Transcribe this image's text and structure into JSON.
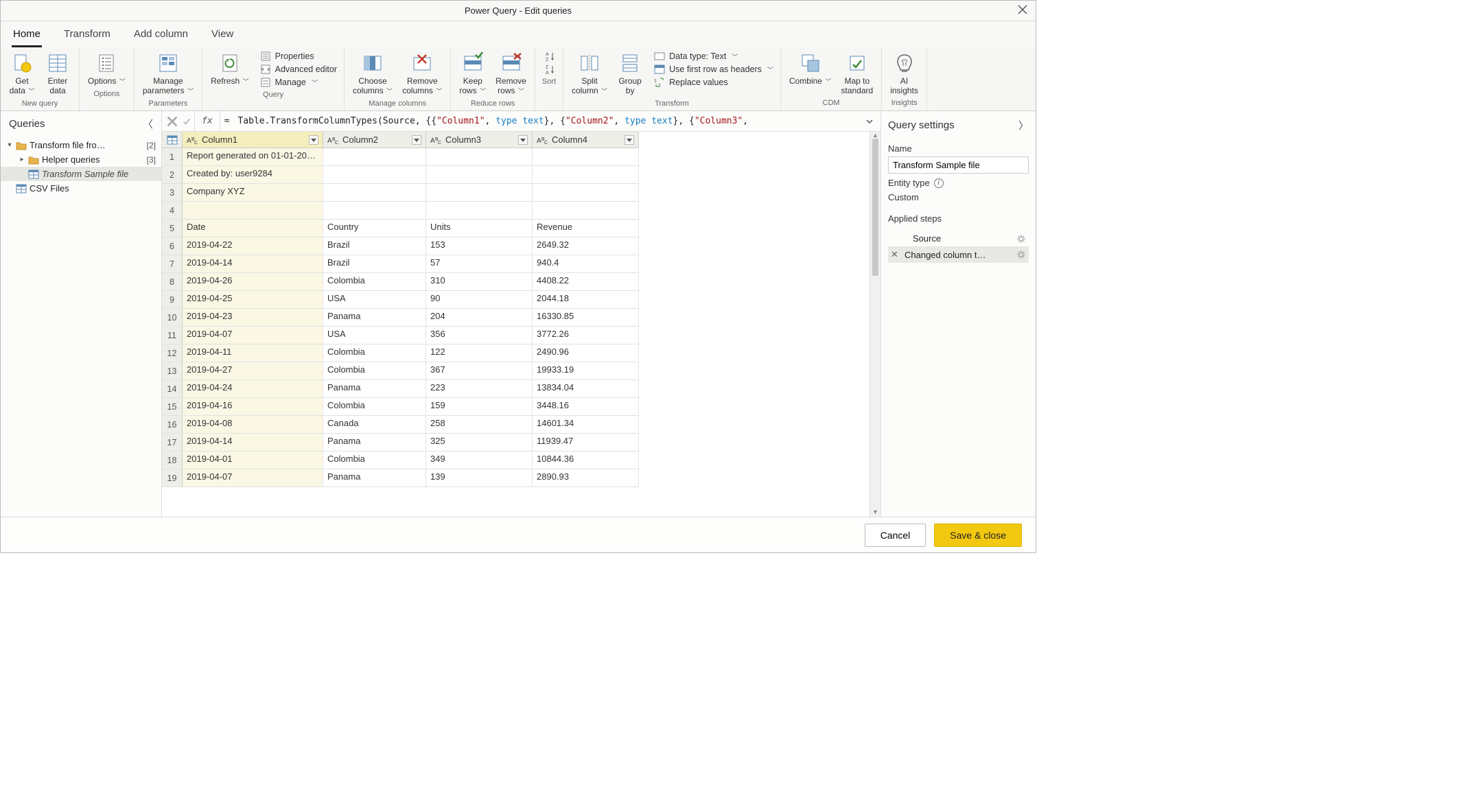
{
  "title": "Power Query - Edit queries",
  "tabs": [
    "Home",
    "Transform",
    "Add column",
    "View"
  ],
  "active_tab": 0,
  "ribbon": {
    "groups": [
      {
        "label": "New query",
        "buttons_lg": [
          {
            "label": "Get\ndata",
            "drop": true,
            "name": "get-data"
          },
          {
            "label": "Enter\ndata",
            "name": "enter-data"
          }
        ],
        "buttons_sm": []
      },
      {
        "label": "Options",
        "buttons_lg": [
          {
            "label": "Options",
            "drop": true,
            "name": "options"
          }
        ],
        "buttons_sm": []
      },
      {
        "label": "Parameters",
        "buttons_lg": [
          {
            "label": "Manage\nparameters",
            "drop": true,
            "name": "manage-parameters"
          }
        ],
        "buttons_sm": []
      },
      {
        "label": "Query",
        "buttons_lg": [
          {
            "label": "Refresh",
            "drop": true,
            "name": "refresh"
          }
        ],
        "buttons_sm": [
          {
            "label": "Properties",
            "name": "properties"
          },
          {
            "label": "Advanced editor",
            "name": "advanced-editor"
          },
          {
            "label": "Manage",
            "drop": true,
            "name": "manage-query"
          }
        ]
      },
      {
        "label": "Manage columns",
        "buttons_lg": [
          {
            "label": "Choose\ncolumns",
            "drop": true,
            "name": "choose-columns"
          },
          {
            "label": "Remove\ncolumns",
            "drop": true,
            "name": "remove-columns"
          }
        ],
        "buttons_sm": []
      },
      {
        "label": "Reduce rows",
        "buttons_lg": [
          {
            "label": "Keep\nrows",
            "drop": true,
            "name": "keep-rows"
          },
          {
            "label": "Remove\nrows",
            "drop": true,
            "name": "remove-rows"
          }
        ],
        "buttons_sm": []
      },
      {
        "label": "Sort",
        "buttons_lg": [],
        "buttons_sm": [
          {
            "label": "",
            "name": "sort-asc"
          },
          {
            "label": "",
            "name": "sort-desc"
          }
        ],
        "stacked": true
      },
      {
        "label": "Transform",
        "buttons_lg": [
          {
            "label": "Split\ncolumn",
            "drop": true,
            "name": "split-column"
          },
          {
            "label": "Group\nby",
            "name": "group-by"
          }
        ],
        "buttons_sm": [
          {
            "label": "Data type: Text",
            "drop": true,
            "name": "data-type"
          },
          {
            "label": "Use first row as headers",
            "drop": true,
            "name": "first-row-headers"
          },
          {
            "label": "Replace values",
            "name": "replace-values"
          }
        ]
      },
      {
        "label": "CDM",
        "buttons_lg": [
          {
            "label": "Combine",
            "drop": true,
            "name": "combine"
          },
          {
            "label": "Map to\nstandard",
            "name": "map-to-standard"
          }
        ],
        "buttons_sm": []
      },
      {
        "label": "Insights",
        "buttons_lg": [
          {
            "label": "AI\ninsights",
            "name": "ai-insights"
          }
        ],
        "buttons_sm": []
      }
    ]
  },
  "queries_pane": {
    "title": "Queries",
    "items": [
      {
        "indent": 0,
        "expand": "▾",
        "icon": "folder",
        "label": "Transform file fro…",
        "count": "[2]",
        "name": "folder-transform-file-from"
      },
      {
        "indent": 1,
        "expand": "▸",
        "icon": "folder",
        "label": "Helper queries",
        "count": "[3]",
        "name": "folder-helper-queries"
      },
      {
        "indent": 1,
        "expand": "",
        "icon": "table",
        "label": "Transform Sample file",
        "selected": true,
        "italic": true,
        "name": "query-transform-sample-file"
      },
      {
        "indent": 0,
        "expand": "",
        "icon": "table",
        "label": "CSV Files",
        "name": "query-csv-files"
      }
    ]
  },
  "formula_bar": {
    "prefix": "Table.TransformColumnTypes(Source, {{",
    "s1": "\"Column1\"",
    "mid1": ", ",
    "kw": "type text",
    "mid2": "}, {",
    "s2": "\"Column2\"",
    "mid3": ", ",
    "kw2": "type text",
    "mid4": "}, {",
    "s3": "\"Column3\"",
    "tail": ","
  },
  "grid": {
    "columns": [
      {
        "name": "Column1",
        "selected": true
      },
      {
        "name": "Column2"
      },
      {
        "name": "Column3"
      },
      {
        "name": "Column4"
      }
    ],
    "rows": [
      [
        "Report generated on 01-01-20…",
        "",
        "",
        ""
      ],
      [
        "Created by: user9284",
        "",
        "",
        ""
      ],
      [
        "Company XYZ",
        "",
        "",
        ""
      ],
      [
        "",
        "",
        "",
        ""
      ],
      [
        "Date",
        "Country",
        "Units",
        "Revenue"
      ],
      [
        "2019-04-22",
        "Brazil",
        "153",
        "2649.32"
      ],
      [
        "2019-04-14",
        "Brazil",
        "57",
        "940.4"
      ],
      [
        "2019-04-26",
        "Colombia",
        "310",
        "4408.22"
      ],
      [
        "2019-04-25",
        "USA",
        "90",
        "2044.18"
      ],
      [
        "2019-04-23",
        "Panama",
        "204",
        "16330.85"
      ],
      [
        "2019-04-07",
        "USA",
        "356",
        "3772.26"
      ],
      [
        "2019-04-11",
        "Colombia",
        "122",
        "2490.96"
      ],
      [
        "2019-04-27",
        "Colombia",
        "367",
        "19933.19"
      ],
      [
        "2019-04-24",
        "Panama",
        "223",
        "13834.04"
      ],
      [
        "2019-04-16",
        "Colombia",
        "159",
        "3448.16"
      ],
      [
        "2019-04-08",
        "Canada",
        "258",
        "14601.34"
      ],
      [
        "2019-04-14",
        "Panama",
        "325",
        "11939.47"
      ],
      [
        "2019-04-01",
        "Colombia",
        "349",
        "10844.36"
      ],
      [
        "2019-04-07",
        "Panama",
        "139",
        "2890.93"
      ]
    ]
  },
  "settings": {
    "title": "Query settings",
    "name_label": "Name",
    "name_value": "Transform Sample file",
    "entity_label": "Entity type",
    "entity_value": "Custom",
    "steps_label": "Applied steps",
    "steps": [
      {
        "label": "Source",
        "gear": true,
        "selected": false
      },
      {
        "label": "Changed column t…",
        "gear": true,
        "selected": true,
        "removable": true
      }
    ]
  },
  "footer": {
    "cancel": "Cancel",
    "save": "Save & close"
  }
}
